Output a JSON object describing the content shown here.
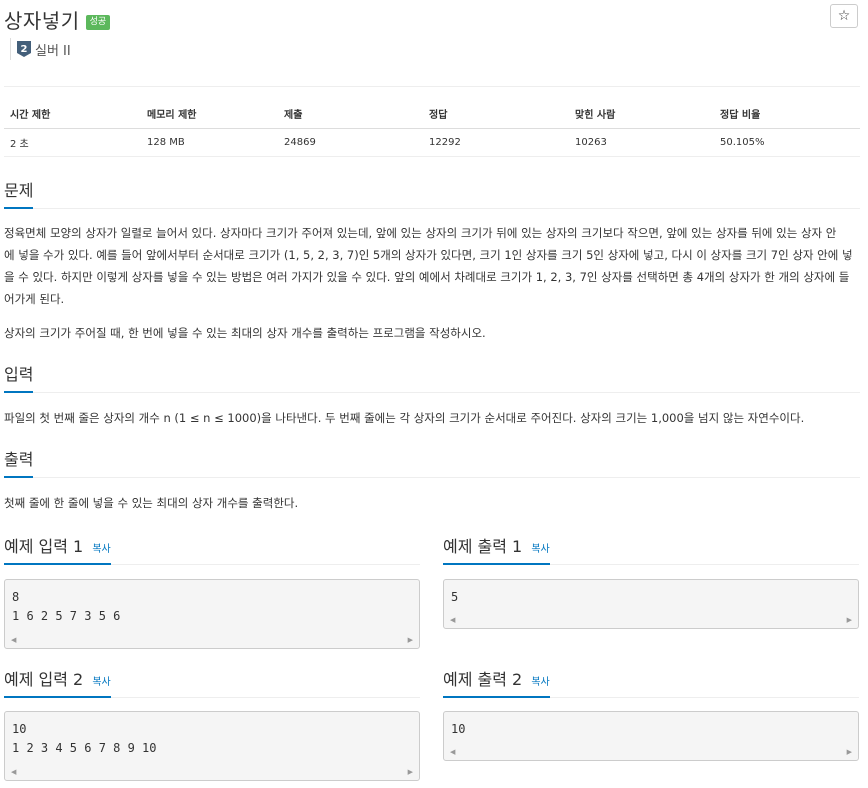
{
  "problem": {
    "title": "상자넣기",
    "result_badge": "성공",
    "star_icon": "☆",
    "tier_number": "2",
    "tier_label": "실버 II"
  },
  "stats": {
    "headers": [
      "시간 제한",
      "메모리 제한",
      "제출",
      "정답",
      "맞힌 사람",
      "정답 비율"
    ],
    "values": [
      "2 초",
      "128 MB",
      "24869",
      "12292",
      "10263",
      "50.105%"
    ]
  },
  "sections": {
    "problem_heading": "문제",
    "problem_lines": [
      "정육면체 모양의 상자가 일렬로 늘어서 있다. 상자마다 크기가 주어져 있는데, 앞에 있는 상자의 크기가 뒤에 있는 상자의 크기보다 작으면, 앞에 있는 상자를 뒤에 있는 상자 안",
      "에 넣을 수가 있다. 예를 들어 앞에서부터 순서대로 크기가 (1, 5, 2, 3, 7)인 5개의 상자가 있다면, 크기 1인 상자를 크기 5인 상자에 넣고, 다시 이 상자를 크기 7인 상자 안에 넣",
      "을 수 있다. 하지만 이렇게 상자를 넣을 수 있는 방법은 여러 가지가 있을 수 있다. 앞의 예에서 차례대로 크기가 1, 2, 3, 7인 상자를 선택하면 총 4개의 상자가 한 개의 상자에 들",
      "어가게 된다."
    ],
    "problem_line2": "상자의 크기가 주어질 때, 한 번에 넣을 수 있는 최대의 상자 개수를 출력하는 프로그램을 작성하시오.",
    "input_heading": "입력",
    "input_text": "파일의 첫 번째 줄은 상자의 개수 n (1 ≤ n ≤ 1000)을 나타낸다. 두 번째 줄에는 각 상자의 크기가 순서대로 주어진다. 상자의 크기는 1,000을 넘지 않는 자연수이다.",
    "output_heading": "출력",
    "output_text": "첫째 줄에 한 줄에 넣을 수 있는 최대의 상자 개수를 출력한다."
  },
  "samples": {
    "copy_label": "복사",
    "input1_heading": "예제 입력 1",
    "input1": "8\n1 6 2 5 7 3 5 6",
    "output1_heading": "예제 출력 1",
    "output1": "5",
    "input2_heading": "예제 입력 2",
    "input2": "10\n1 2 3 4 5 6 7 8 9 10",
    "output2_heading": "예제 출력 2",
    "output2": "10"
  },
  "colors": {
    "accent": "#0076c0",
    "success": "#5cb85c",
    "tier": "#435f7a"
  }
}
